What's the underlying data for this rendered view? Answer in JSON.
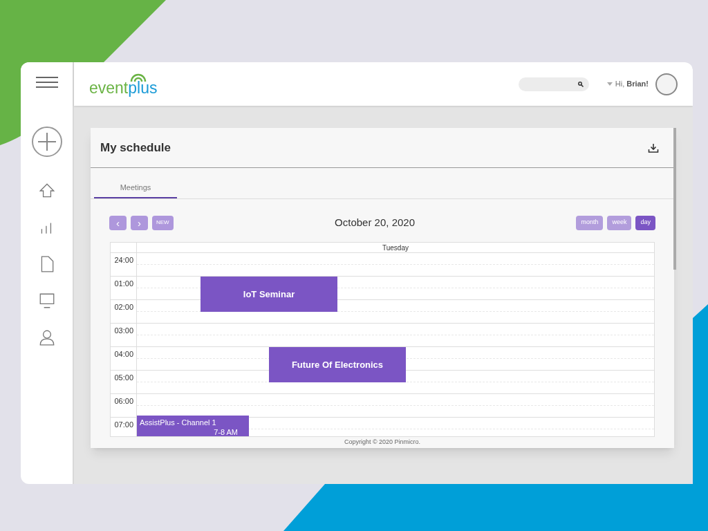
{
  "logo": {
    "part1": "event",
    "part2": "plus"
  },
  "user": {
    "greeting": "Hi,",
    "name": "Brian!"
  },
  "sidebar": {
    "items": [
      {
        "kind": "home"
      },
      {
        "kind": "chart"
      },
      {
        "kind": "document"
      },
      {
        "kind": "monitor"
      },
      {
        "kind": "user"
      }
    ]
  },
  "card": {
    "title": "My schedule"
  },
  "tabs": [
    {
      "label": "Meetings",
      "selected": true
    }
  ],
  "toolbar": {
    "prev": "‹",
    "next": "›",
    "new": "NEW",
    "date": "October 20, 2020"
  },
  "views": [
    {
      "label": "month",
      "selected": false
    },
    {
      "label": "week",
      "selected": false
    },
    {
      "label": "day",
      "selected": true
    }
  ],
  "calendar": {
    "day": "Tuesday",
    "hours": [
      "24:00",
      "01:00",
      "02:00",
      "03:00",
      "04:00",
      "05:00",
      "06:00",
      "07:00"
    ],
    "events": [
      {
        "title": "IoT Seminar",
        "kind": "block"
      },
      {
        "title": "Future Of Electronics",
        "kind": "block"
      },
      {
        "title": "AssistPlus - Channel 1",
        "time": "7-8 AM",
        "kind": "detail"
      }
    ]
  },
  "footer": "Copyright © 2020 Pinmicro."
}
